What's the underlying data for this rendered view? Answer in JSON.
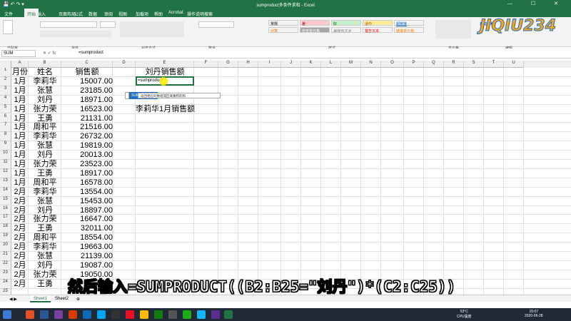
{
  "window": {
    "title": "sumproduct多条件求和 - Excel"
  },
  "tabs": [
    "文件",
    "开始",
    "插入",
    "页面布局",
    "公式",
    "数据",
    "审阅",
    "视图",
    "加载项",
    "帮助",
    "Acrobat",
    "操作说明搜索"
  ],
  "ribbon_groups": [
    "剪贴板",
    "字体",
    "对齐方式",
    "数字",
    "样式",
    "单元格",
    "编辑"
  ],
  "styles": [
    "常规",
    "差",
    "好",
    "适中",
    "超链接",
    "计算",
    "检查单元格",
    "解释性文本",
    "警告文本",
    "链接单元格"
  ],
  "autosum": "自动求和",
  "namebox": "SUM",
  "formula": "=sumproduct",
  "columns": [
    "A",
    "B",
    "C",
    "D",
    "E",
    "F",
    "G",
    "H",
    "I",
    "J",
    "K",
    "L",
    "M",
    "N",
    "O",
    "P",
    "Q",
    "R",
    "S",
    "T",
    "U"
  ],
  "headers": {
    "month": "月份",
    "name": "姓名",
    "sales": "销售额"
  },
  "rows": [
    [
      "1月",
      "李莉华",
      "15007.00"
    ],
    [
      "1月",
      "张慧",
      "23185.00"
    ],
    [
      "1月",
      "刘丹",
      "18971.00"
    ],
    [
      "1月",
      "张力荣",
      "16523.00"
    ],
    [
      "1月",
      "王勇",
      "21131.00"
    ],
    [
      "1月",
      "周和平",
      "21516.00"
    ],
    [
      "1月",
      "李莉华",
      "26732.00"
    ],
    [
      "1月",
      "张慧",
      "19819.00"
    ],
    [
      "1月",
      "刘丹",
      "20013.00"
    ],
    [
      "1月",
      "张力荣",
      "23523.00"
    ],
    [
      "1月",
      "王勇",
      "18917.00"
    ],
    [
      "1月",
      "周和平",
      "16578.00"
    ],
    [
      "2月",
      "李莉华",
      "13554.00"
    ],
    [
      "2月",
      "张慧",
      "15453.00"
    ],
    [
      "2月",
      "刘丹",
      "18897.00"
    ],
    [
      "2月",
      "张力荣",
      "16647.00"
    ],
    [
      "2月",
      "王勇",
      "32011.00"
    ],
    [
      "2月",
      "周和平",
      "18554.00"
    ],
    [
      "2月",
      "李莉华",
      "19663.00"
    ],
    [
      "2月",
      "张慧",
      "21139.00"
    ],
    [
      "2月",
      "刘丹",
      "19087.00"
    ],
    [
      "2月",
      "张力荣",
      "19050.00"
    ],
    [
      "2月",
      "王勇",
      ""
    ]
  ],
  "e1": "刘丹销售额",
  "e2": "=sumproduct",
  "e5": "李莉华1月销售额",
  "autocomplete": {
    "item": "SUMPRODUCT",
    "tip": "返回相应的数组或区域乘积的和"
  },
  "sheets": [
    "Sheet1",
    "Sheet2"
  ],
  "logo": "JIQIU234",
  "subtitle": "然后输入=SUMPRODUCT((B2:B25=\"刘丹\")*(C2:C25))",
  "tray": {
    "temp": "53°C",
    "cpu": "CPU温度",
    "time": "15:07",
    "date": "2020-06-28"
  }
}
